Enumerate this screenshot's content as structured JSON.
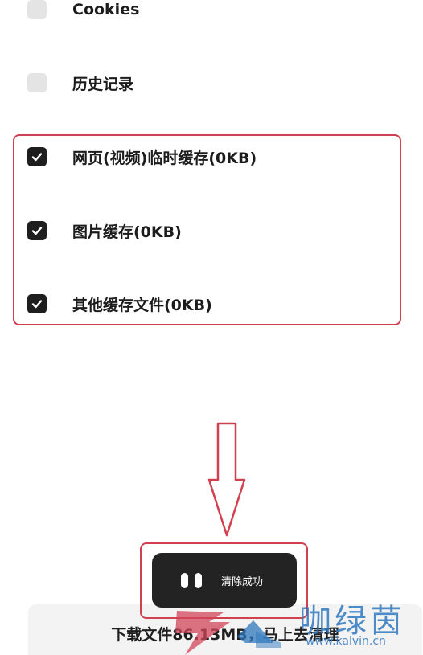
{
  "options": [
    {
      "label": "Cookies",
      "checked": false
    },
    {
      "label": "历史记录",
      "checked": false
    },
    {
      "label": "网页(视频)临时缓存(0KB)",
      "checked": true
    },
    {
      "label": "图片缓存(0KB)",
      "checked": true
    },
    {
      "label": "其他缓存文件(0KB)",
      "checked": true
    }
  ],
  "toast": {
    "text": "清除成功",
    "icon": "pause-icon"
  },
  "clean_button": {
    "label": "下载文件86.13MB，马上去清理"
  },
  "watermark": {
    "name": "咖绿茵",
    "url": "www.kalvin.cn"
  },
  "colors": {
    "highlight": "#d0404f",
    "checkbox_checked": "#1e1e1e",
    "checkbox_unchecked": "#e4e4e4",
    "toast_bg": "#232323",
    "watermark": "#2e78be"
  }
}
